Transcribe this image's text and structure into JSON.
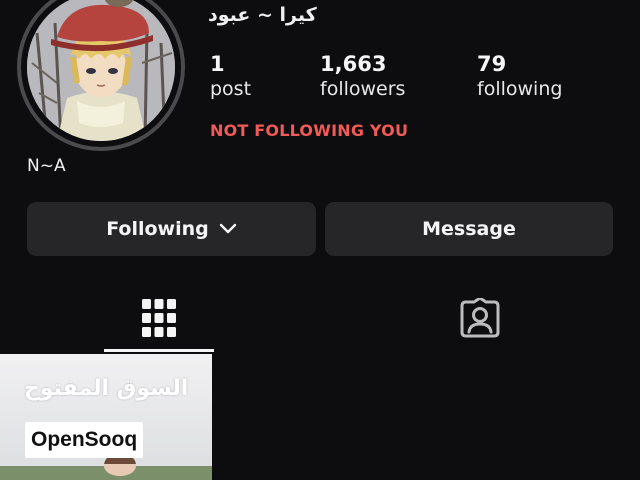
{
  "profile": {
    "display_name": "كيرا ~ عبود",
    "bio": "N~A",
    "relationship_status": "NOT FOLLOWING YOU"
  },
  "stats": {
    "posts": {
      "count": "1",
      "label": "post"
    },
    "followers": {
      "count": "1,663",
      "label": "followers"
    },
    "following": {
      "count": "79",
      "label": "following"
    }
  },
  "actions": {
    "following_label": "Following",
    "message_label": "Message"
  },
  "tabs": [
    {
      "name": "posts-grid",
      "icon": "grid-icon",
      "active": true
    },
    {
      "name": "tagged",
      "icon": "tagged-person-icon",
      "active": false
    }
  ],
  "post_thumbnail": {
    "arabic_text": "السوق المفتوح",
    "brand_text": "OpenSooq"
  },
  "colors": {
    "background": "#0d0d0f",
    "button": "#262629",
    "warning_red": "#f15a57",
    "text": "#f5f5f5"
  }
}
